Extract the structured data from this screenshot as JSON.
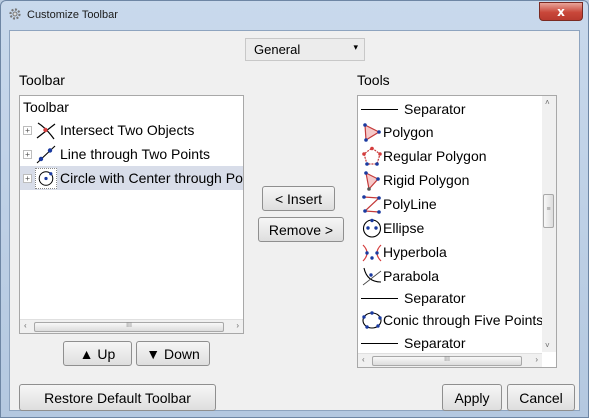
{
  "window": {
    "title": "Customize Toolbar",
    "close_symbol": "x"
  },
  "category": {
    "selected": "General",
    "arrow": "▾"
  },
  "left": {
    "section_label": "Toolbar",
    "tree_root": "Toolbar",
    "items": [
      {
        "label": "Intersect Two Objects",
        "icon": "intersect-two-objects-icon",
        "expander": "+"
      },
      {
        "label": "Line through Two Points",
        "icon": "line-through-two-points-icon",
        "expander": "+"
      },
      {
        "label": "Circle with Center through Point",
        "icon": "circle-center-point-icon",
        "expander": "+",
        "selected": true
      }
    ],
    "scroll_left": "‹",
    "scroll_right": "›",
    "scroll_grip": "III"
  },
  "middle": {
    "insert_label": "< Insert",
    "remove_label": "Remove >"
  },
  "move": {
    "up_label": "▲ Up",
    "down_label": "▼ Down"
  },
  "right": {
    "section_label": "Tools",
    "rows": [
      {
        "type": "separator",
        "label": "Separator"
      },
      {
        "type": "tool",
        "label": "Polygon",
        "icon": "polygon-icon"
      },
      {
        "type": "tool",
        "label": "Regular Polygon",
        "icon": "regular-polygon-icon"
      },
      {
        "type": "tool",
        "label": "Rigid Polygon",
        "icon": "rigid-polygon-icon"
      },
      {
        "type": "tool",
        "label": "PolyLine",
        "icon": "polyline-icon"
      },
      {
        "type": "tool",
        "label": "Ellipse",
        "icon": "ellipse-icon"
      },
      {
        "type": "tool",
        "label": "Hyperbola",
        "icon": "hyperbola-icon"
      },
      {
        "type": "tool",
        "label": "Parabola",
        "icon": "parabola-icon"
      },
      {
        "type": "separator",
        "label": "Separator"
      },
      {
        "type": "tool",
        "label": "Conic through Five Points",
        "icon": "conic-five-points-icon"
      },
      {
        "type": "separator",
        "label": "Separator"
      }
    ],
    "scroll_up": "˄",
    "scroll_down": "˅",
    "scroll_left": "‹",
    "scroll_right": "›",
    "scroll_grip": "III",
    "vscroll_grip": "≡"
  },
  "footer": {
    "restore_label": "Restore Default Toolbar",
    "apply_label": "Apply",
    "cancel_label": "Cancel"
  },
  "colors": {
    "title_gradient_top": "#c9d9ec",
    "close_red": "#c9473a",
    "selection_bg": "#d8dde9",
    "icon_blue": "#1a3aa0",
    "icon_red": "#d43c3c"
  }
}
